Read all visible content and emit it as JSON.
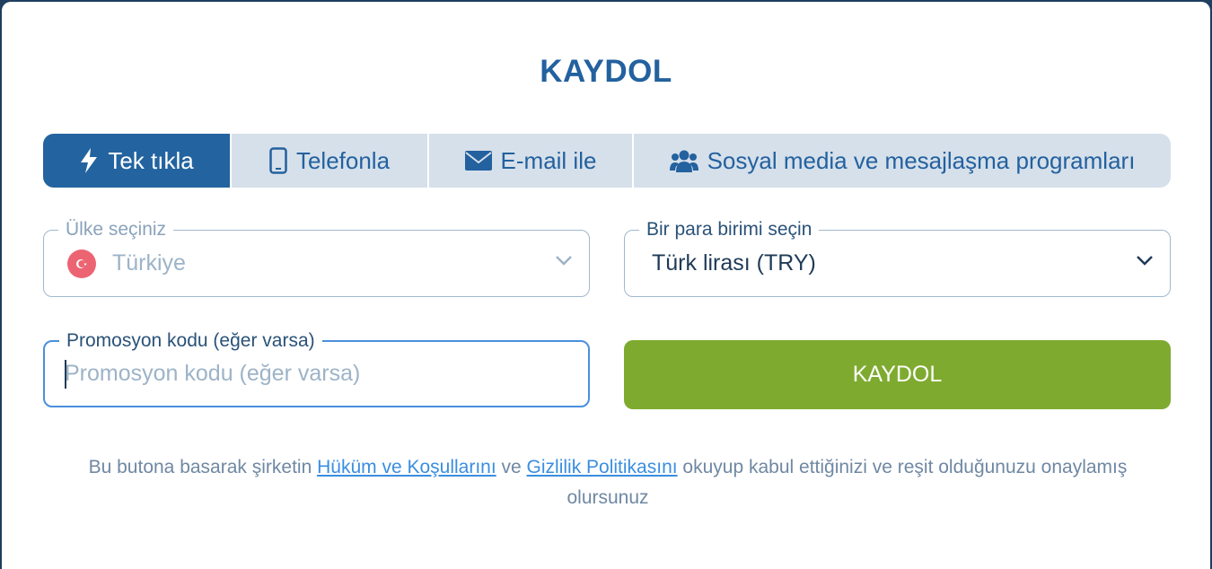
{
  "title": "KAYDOL",
  "tabs": [
    {
      "label": "Tek tıkla",
      "icon": "lightning-icon",
      "active": true
    },
    {
      "label": "Telefonla",
      "icon": "phone-icon",
      "active": false
    },
    {
      "label": "E-mail ile",
      "icon": "envelope-icon",
      "active": false
    },
    {
      "label": "Sosyal media ve mesajlaşma programları",
      "icon": "users-icon",
      "active": false
    }
  ],
  "country": {
    "legend": "Ülke seçiniz",
    "value": "Türkiye",
    "icon": "turkey-flag-icon"
  },
  "currency": {
    "legend": "Bir para birimi seçin",
    "value": "Türk lirası (TRY)"
  },
  "promo": {
    "legend": "Promosyon kodu (eğer varsa)",
    "placeholder": "Promosyon kodu (eğer varsa)",
    "value": ""
  },
  "submit_label": "KAYDOL",
  "legal": {
    "prefix": "Bu butona basarak şirketin ",
    "terms_link": "Hüküm ve Koşullarını",
    "middle": " ve ",
    "privacy_link": "Gizlilik Politikasını",
    "suffix": " okuyup kabul ettiğinizi ve reşit olduğunuzu onaylamış olursunuz"
  },
  "colors": {
    "primary": "#2363a0",
    "tab_bg": "#d6e0ea",
    "submit": "#7eab2f",
    "link": "#3a8ee0"
  }
}
